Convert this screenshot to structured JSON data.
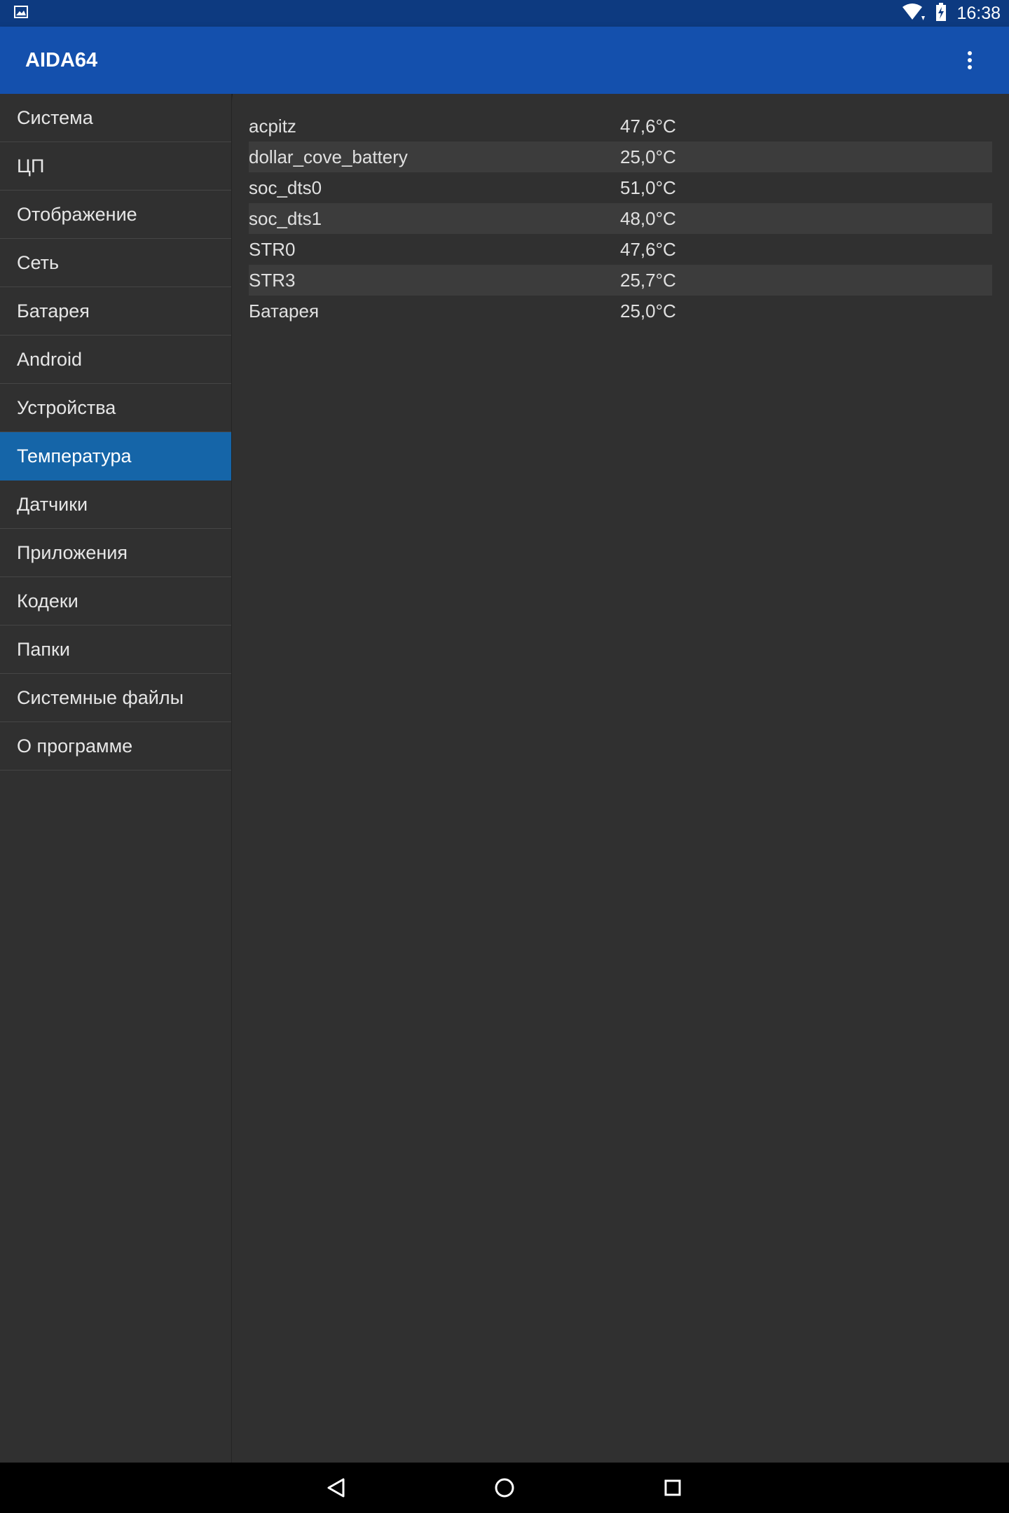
{
  "status_bar": {
    "time": "16:38",
    "icons": [
      "image-notification-icon",
      "wifi-icon",
      "battery-charging-icon"
    ]
  },
  "app_bar": {
    "title": "AIDA64",
    "menu_icon": "overflow-menu-icon"
  },
  "sidebar": {
    "selected_index": 7,
    "items": [
      {
        "label": "Система"
      },
      {
        "label": "ЦП"
      },
      {
        "label": "Отображение"
      },
      {
        "label": "Сеть"
      },
      {
        "label": "Батарея"
      },
      {
        "label": "Android"
      },
      {
        "label": "Устройства"
      },
      {
        "label": "Температура"
      },
      {
        "label": "Датчики"
      },
      {
        "label": "Приложения"
      },
      {
        "label": "Кодеки"
      },
      {
        "label": "Папки"
      },
      {
        "label": "Системные файлы"
      },
      {
        "label": "О программе"
      }
    ]
  },
  "temperatures": [
    {
      "name": "acpitz",
      "value": "47,6°C"
    },
    {
      "name": "dollar_cove_battery",
      "value": "25,0°C"
    },
    {
      "name": "soc_dts0",
      "value": "51,0°C"
    },
    {
      "name": "soc_dts1",
      "value": "48,0°C"
    },
    {
      "name": "STR0",
      "value": "47,6°C"
    },
    {
      "name": "STR3",
      "value": "25,7°C"
    },
    {
      "name": "Батарея",
      "value": "25,0°C"
    }
  ],
  "nav_bar": {
    "buttons": [
      "back-icon",
      "home-icon",
      "recents-icon"
    ]
  },
  "colors": {
    "status_bar": "#0d3a80",
    "app_bar": "#1450ad",
    "selected_item": "#1565a8",
    "background": "#303030"
  }
}
